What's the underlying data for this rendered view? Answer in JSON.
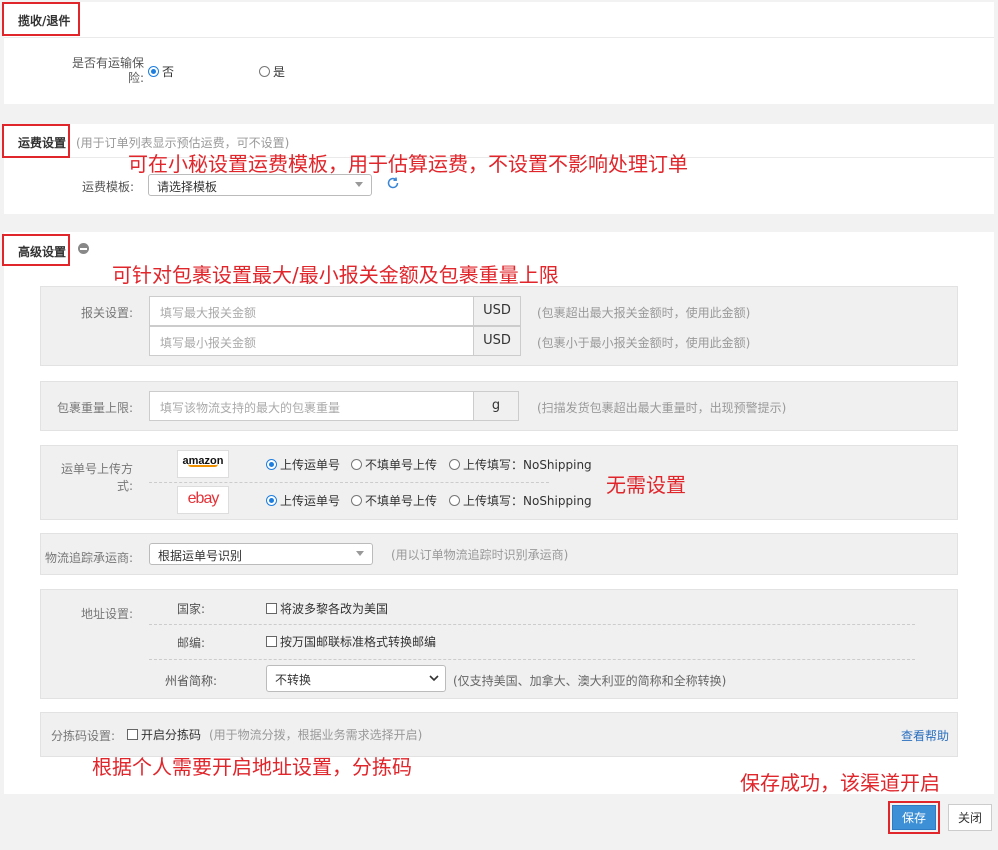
{
  "sections": {
    "receive": {
      "title": "揽收/退件",
      "insurance_label": "是否有运输保险:",
      "options": [
        "否",
        "是"
      ],
      "selected": "否"
    },
    "freight": {
      "title": "运费设置",
      "hint": "(用于订单列表显示预估运费，可不设置)",
      "template_label": "运费模板:",
      "template_value": "请选择模板",
      "refresh_icon": "refresh-icon"
    },
    "advanced": {
      "title": "高级设置",
      "collapse_icon": "minus-circle-icon",
      "customs": {
        "label": "报关设置:",
        "max_placeholder": "填写最大报关金额",
        "min_placeholder": "填写最小报关金额",
        "currency": "USD",
        "max_hint": "(包裹超出最大报关金额时，使用此金额)",
        "min_hint": "(包裹小于最小报关金额时，使用此金额)"
      },
      "weight": {
        "label": "包裹重量上限:",
        "placeholder": "填写该物流支持的最大的包裹重量",
        "unit": "g",
        "hint": "(扫描发货包裹超出最大重量时，出现预警提示)"
      },
      "upload": {
        "label": "运单号上传方式:",
        "platforms": [
          {
            "name": "amazon",
            "options": [
              "上传运单号",
              "不填单号上传",
              "上传填写：NoShipping"
            ],
            "selected": 0
          },
          {
            "name": "ebay",
            "options": [
              "上传运单号",
              "不填单号上传",
              "上传填写：NoShipping"
            ],
            "selected": 0
          }
        ]
      },
      "tracking": {
        "label": "物流追踪承运商:",
        "value": "根据运单号识别",
        "hint": "(用以订单物流追踪时识别承运商)"
      },
      "address": {
        "label": "地址设置:",
        "country_label": "国家:",
        "country_option": "将波多黎各改为美国",
        "zip_label": "邮编:",
        "zip_option": "按万国邮联标准格式转换邮编",
        "state_label": "州省简称:",
        "state_value": "不转换",
        "state_hint": "(仅支持美国、加拿大、澳大利亚的简称和全称转换)"
      },
      "sorting": {
        "label": "分拣码设置:",
        "option": "开启分拣码",
        "hint": "(用于物流分拨，根据业务需求选择开启)",
        "help_link": "查看帮助"
      }
    }
  },
  "annotations": {
    "freight_note": "可在小秘设置运费模板，用于估算运费，不设置不影响处理订单",
    "advanced_note": "可针对包裹设置最大/最小报关金额及包裹重量上限",
    "upload_note": "无需设置",
    "address_note": "根据个人需要开启地址设置，分拣码",
    "save_note": "保存成功，该渠道开启"
  },
  "footer": {
    "save_label": "保存",
    "close_label": "关闭"
  },
  "colors": {
    "annotation_red": "#e0252b",
    "primary_blue": "#3d8fd6",
    "link_blue": "#2a6fbf"
  }
}
